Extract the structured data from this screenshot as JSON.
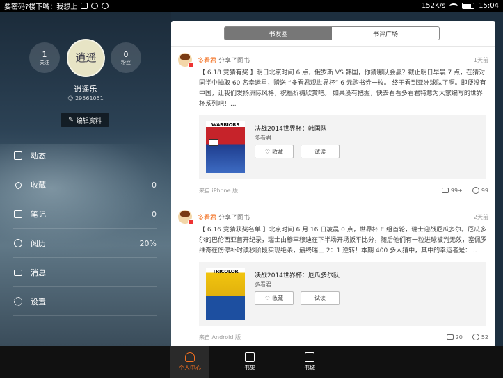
{
  "statusbar": {
    "notification": "要密码?楼下喊：我想上",
    "speed": "152K/s",
    "time": "15:04"
  },
  "profile": {
    "following_count": "1",
    "following_label": "关注",
    "followers_count": "0",
    "followers_label": "粉丝",
    "avatar_text": "逍遥",
    "username": "逍遥乐",
    "user_id": "29561051",
    "edit_label": "编辑资料"
  },
  "menu": [
    {
      "label": "动态",
      "value": ""
    },
    {
      "label": "收藏",
      "value": "0"
    },
    {
      "label": "笔记",
      "value": "0"
    },
    {
      "label": "阅历",
      "value": "20%"
    },
    {
      "label": "消息",
      "value": ""
    },
    {
      "label": "设置",
      "value": ""
    }
  ],
  "tabs": {
    "friends": "书友圈",
    "reviews": "书评广场"
  },
  "posts": [
    {
      "author": "多看君",
      "action": "分享了图书",
      "time": "1天前",
      "text": "【 6.18 竞猜有奖 】明日北京时间 6 点，俄罗斯 VS 韩国，你猜哪队会赢？截止明日早晨 7 点，在猜对同学中抽取 60 名幸运星，赠送 “多看君观世界杯” 6 元购书券一枚。 终于看到亚洲球队了啊。即便没有中国，让我们发扬洲际风格，祝福折祷欣赏吧。 如果没有把握，快去看看多看君特意为大家编写的世界杯系列吧！...",
      "cover_title": "WARRIORS",
      "book_title": "决战2014世界杯：韩国队",
      "book_author": "多看君",
      "collect_label": "收藏",
      "trial_label": "试读",
      "source": "来自 iPhone 版",
      "comments": "99+",
      "likes": "99"
    },
    {
      "author": "多看君",
      "action": "分享了图书",
      "time": "2天前",
      "text": "【 6.16 竞猜获奖名单 】北京时间 6 月 16 日凌晨 0 点，世界杯 E 组首轮，瑞士迎战厄瓜多尔。厄瓜多尔的巴伦西亚首开纪录，瑞士由穆罕穆迪在下半场开场扳平比分，随后他们有一粒进球被判无效，塞佩罗维奇在伤停补时读秒阶段实现绝杀，最终瑞士 2：1 逆转！本期 400 多人猜中，其中的幸运者是：...",
      "cover_title": "TRICOLOR",
      "book_title": "决战2014世界杯：厄瓜多尔队",
      "book_author": "多看君",
      "collect_label": "收藏",
      "trial_label": "试读",
      "source": "来自 Android 版",
      "comments": "20",
      "likes": "52"
    }
  ],
  "bottomnav": {
    "personal": "个人中心",
    "shelf": "书架",
    "store": "书城"
  },
  "colors": {
    "accent": "#f37021",
    "tab_active": "#777777"
  }
}
